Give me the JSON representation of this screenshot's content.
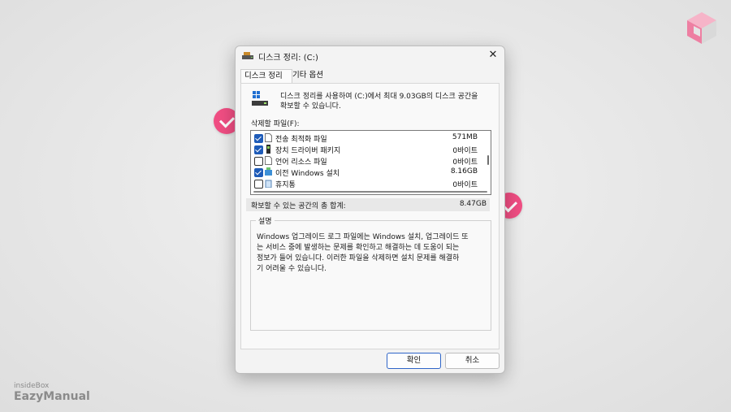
{
  "window": {
    "title": "디스크 정리: (C:)",
    "close_glyph": "✕"
  },
  "tabs": [
    {
      "label": "디스크 정리",
      "active": true
    },
    {
      "label": "기타 옵션",
      "active": false
    }
  ],
  "description": {
    "line1": "디스크 정리를 사용하여 (C:)에서 최대 9.03GB의 디스크 공간을",
    "line2": "확보할 수 있습니다."
  },
  "files_label": "삭제할 파일(F):",
  "files": [
    {
      "name": "전송 최적화 파일",
      "size": "571MB",
      "checked": true
    },
    {
      "name": "장치 드라이버 패키지",
      "size": "0바이트",
      "checked": true
    },
    {
      "name": "언어 리소스 파일",
      "size": "0바이트",
      "checked": false
    },
    {
      "name": "이전 Windows 설치",
      "size": "8.16GB",
      "checked": true
    },
    {
      "name": "휴지통",
      "size": "0바이트",
      "checked": false
    }
  ],
  "total": {
    "label": "확보할 수 있는 공간의 총 합계:",
    "value": "8.47GB"
  },
  "details": {
    "title": "설명",
    "lines": [
      "Windows 업그레이드 로그 파일에는 Windows 설치, 업그레이드 또",
      "는 서비스 중에 발생하는 문제를 확인하고 해결하는 데 도움이 되는",
      "정보가 들어 있습니다. 이러한 파일을 삭제하면 설치 문제를 해결하",
      "기 어려울 수 있습니다."
    ]
  },
  "buttons": {
    "ok": "확인",
    "cancel": "취소"
  },
  "watermark": {
    "small": "insideBox",
    "big": "EazyManual"
  },
  "colors": {
    "badge": "#f04e83",
    "accent": "#2f65c8",
    "checkbox": "#1e5bb8"
  }
}
